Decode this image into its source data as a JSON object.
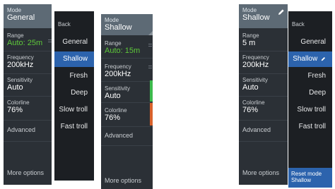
{
  "screen1": {
    "sidebar": {
      "mode": {
        "label": "Mode",
        "value": "General"
      },
      "range": {
        "label": "Range",
        "value": "Auto: 25m"
      },
      "frequency": {
        "label": "Frequency",
        "value": "200kHz"
      },
      "sensitivity": {
        "label": "Sensitivity",
        "value": "Auto"
      },
      "colorline": {
        "label": "Colorline",
        "value": "76%"
      },
      "advanced": "Advanced",
      "more_options": "More options"
    },
    "submenu": {
      "back": "Back",
      "items": [
        "General",
        "Shallow",
        "Fresh",
        "Deep",
        "Slow troll",
        "Fast troll"
      ],
      "selected": "Shallow"
    },
    "sidebar_after": {
      "mode": {
        "label": "Mode",
        "value": "Shallow"
      },
      "range": {
        "label": "Range",
        "value": "Auto: 15m"
      },
      "frequency": {
        "label": "Frequency",
        "value": "200kHz"
      },
      "sensitivity": {
        "label": "Sensitivity",
        "value": "Auto"
      },
      "colorline": {
        "label": "Colorline",
        "value": "76%"
      },
      "advanced": "Advanced",
      "more_options": "More options"
    }
  },
  "screen2": {
    "sidebar": {
      "mode": {
        "label": "Mode",
        "value": "Shallow"
      },
      "range": {
        "label": "Range",
        "value": "5 m"
      },
      "frequency": {
        "label": "Frequency",
        "value": "200kHz"
      },
      "sensitivity": {
        "label": "Sensitivity",
        "value": "Auto"
      },
      "colorline": {
        "label": "Colorline",
        "value": "76%"
      },
      "advanced": "Advanced",
      "more_options": "More options"
    },
    "submenu": {
      "back": "Back",
      "items": [
        "General",
        "Shallow",
        "Fresh",
        "Deep",
        "Slow troll",
        "Fast troll"
      ],
      "selected": "Shallow",
      "reset_line1": "Reset mode",
      "reset_line2": "Shallow"
    }
  },
  "colors": {
    "sidebar_bg": "#2b3036",
    "submenu_bg": "#1c1f23",
    "header_bg": "#5d6a75",
    "selected_bg": "#2c63ad",
    "range_auto": "#5ec83a",
    "marker_green": "#3cba4c",
    "marker_orange": "#d9622b"
  },
  "icons": [
    "pencil-icon",
    "pencil-icon-small"
  ]
}
